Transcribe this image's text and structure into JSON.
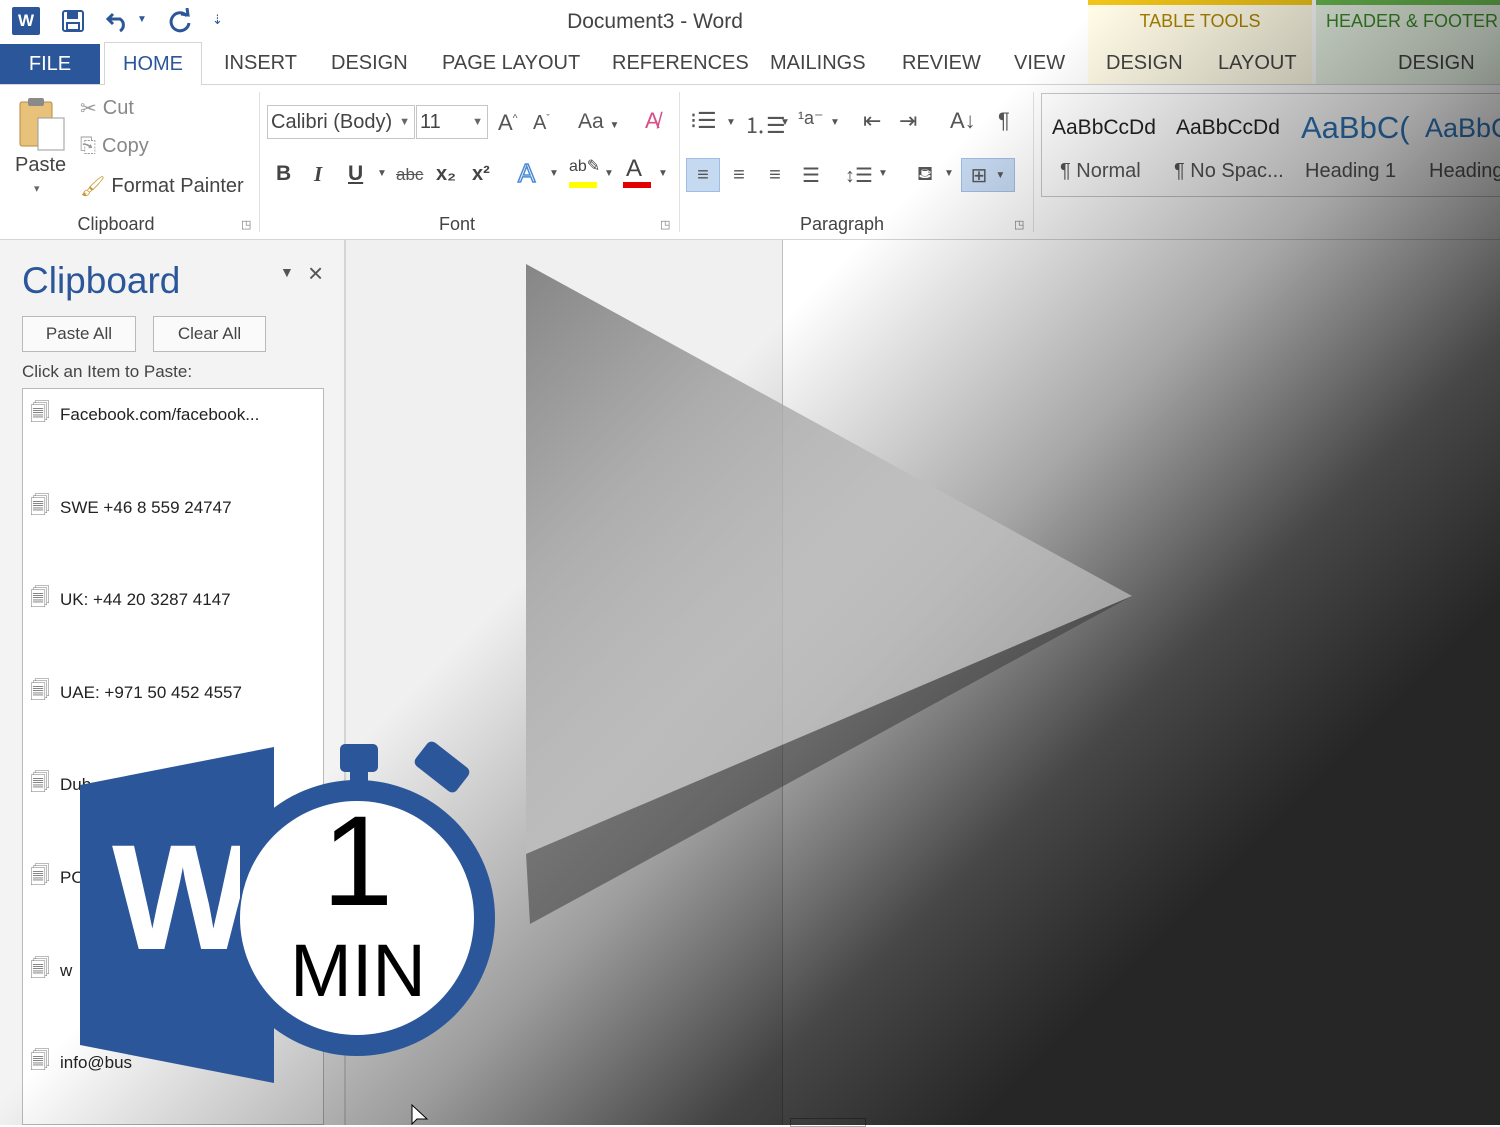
{
  "window": {
    "title": "Document3 - Word",
    "qat": {
      "save_icon": "save-icon",
      "undo_icon": "undo-icon",
      "redo_icon": "redo-icon",
      "customize_icon": "customize-qat-icon"
    }
  },
  "contextual_tabs": {
    "table_tools": {
      "title": "TABLE TOOLS",
      "tabs": [
        "DESIGN",
        "LAYOUT"
      ],
      "color": "#f0c419"
    },
    "header_footer": {
      "title": "HEADER & FOOTER T",
      "tabs": [
        "DESIGN"
      ],
      "color": "#6aba50"
    }
  },
  "tabs": {
    "file": "FILE",
    "home": "HOME",
    "insert": "INSERT",
    "design": "DESIGN",
    "page_layout": "PAGE LAYOUT",
    "references": "REFERENCES",
    "mailings": "MAILINGS",
    "review": "REVIEW",
    "view": "VIEW"
  },
  "ribbon": {
    "clipboard": {
      "label": "Clipboard",
      "paste": "Paste",
      "cut": "Cut",
      "copy": "Copy",
      "format_painter": "Format Painter"
    },
    "font": {
      "label": "Font",
      "font_name": "Calibri (Body)",
      "font_size": "11",
      "bold": "B",
      "italic": "I",
      "underline": "U",
      "strikethrough": "abc",
      "subscript": "x₂",
      "superscript": "x²",
      "change_case": "Aa",
      "highlight_color": "#ffff00",
      "font_color": "#e00000"
    },
    "paragraph": {
      "label": "Paragraph"
    },
    "styles": [
      {
        "sample": "AaBbCcDd",
        "name": "¶ Normal"
      },
      {
        "sample": "AaBbCcDd",
        "name": "¶ No Spac..."
      },
      {
        "sample": "AaBbC(",
        "name": "Heading 1"
      },
      {
        "sample": "AaBbC",
        "name": "Heading"
      }
    ]
  },
  "clipboard_pane": {
    "title": "Clipboard",
    "paste_all": "Paste All",
    "clear_all": "Clear All",
    "instruction": "Click an Item to Paste:",
    "items": [
      "Facebook.com/facebook...",
      "SWE +46 8 559 24747",
      "UK: +44 20 3287 4147",
      "UAE: +971 50 452 4557",
      "Dub",
      "PO",
      "w",
      "info@bus"
    ]
  },
  "badge": {
    "number": "1",
    "unit": "MIN",
    "logo_letter": "W",
    "brand_color": "#2b579a"
  },
  "play_overlay": {
    "icon": "play-icon"
  }
}
